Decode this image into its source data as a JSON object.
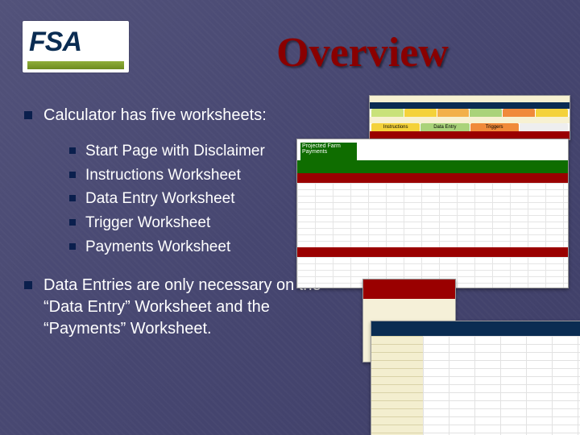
{
  "logo": {
    "text": "FSA"
  },
  "title": "Overview",
  "bullets": [
    {
      "text": "Calculator has five worksheets:",
      "children": [
        "Start Page with Disclaimer",
        "Instructions Worksheet",
        "Data Entry Worksheet",
        "Trigger Worksheet",
        "Payments Worksheet"
      ]
    },
    {
      "text": "Data Entries are only necessary on the “Data Entry” Worksheet and the “Payments” Worksheet."
    }
  ],
  "thumbnails": {
    "main_label": "Projected Farm Payments",
    "tabs_top": [
      "",
      "",
      "",
      "",
      "",
      ""
    ],
    "tabs_mid": [
      "Instructions",
      "Data Entry",
      "Triggers"
    ],
    "side_note": "",
    "colors": {
      "green": "#0f6d00",
      "red": "#9a0000",
      "navy": "#0a2c52",
      "cream": "#f5f0d8"
    }
  }
}
